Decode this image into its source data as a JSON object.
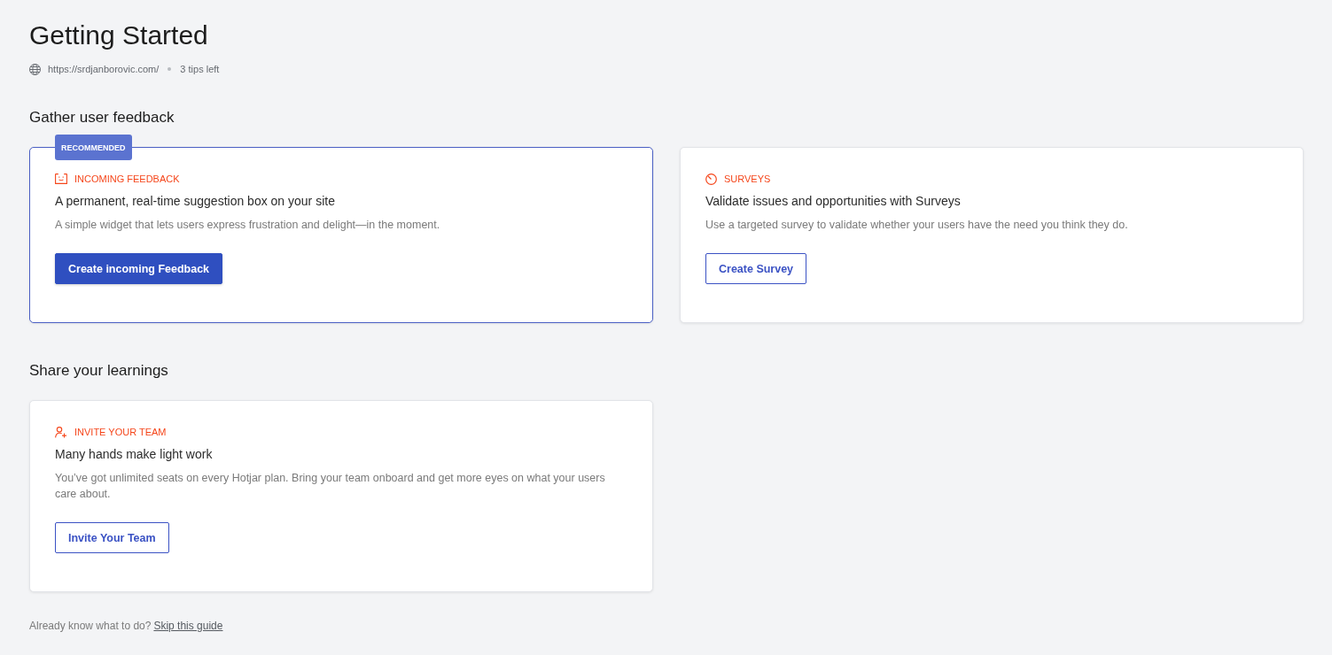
{
  "page": {
    "title": "Getting Started",
    "site_url": "https://srdjanborovic.com/",
    "tips_left": "3 tips left"
  },
  "sections": [
    {
      "heading": "Gather user feedback",
      "cards": [
        {
          "highlighted": true,
          "badge": "RECOMMENDED",
          "kind": "feedback",
          "category": "INCOMING FEEDBACK",
          "title": "A permanent, real-time suggestion box on your site",
          "description": "A simple widget that lets users express frustration and delight—in the moment.",
          "button": {
            "label": "Create incoming Feedback",
            "kind": "primary"
          }
        },
        {
          "highlighted": false,
          "kind": "survey",
          "category": "SURVEYS",
          "title": "Validate issues and opportunities with Surveys",
          "description": "Use a targeted survey to validate whether your users have the need you think they do.",
          "button": {
            "label": "Create Survey",
            "kind": "outline"
          }
        }
      ]
    },
    {
      "heading": "Share your learnings",
      "cards": [
        {
          "highlighted": false,
          "kind": "team",
          "category": "INVITE YOUR TEAM",
          "title": "Many hands make light work",
          "description": "You’ve got unlimited seats on every Hotjar plan. Bring your team onboard and get more eyes on what your users care about.",
          "button": {
            "label": "Invite Your Team",
            "kind": "outline"
          }
        }
      ]
    }
  ],
  "footer": {
    "question": "Already know what to do?",
    "link": "Skip this guide"
  }
}
